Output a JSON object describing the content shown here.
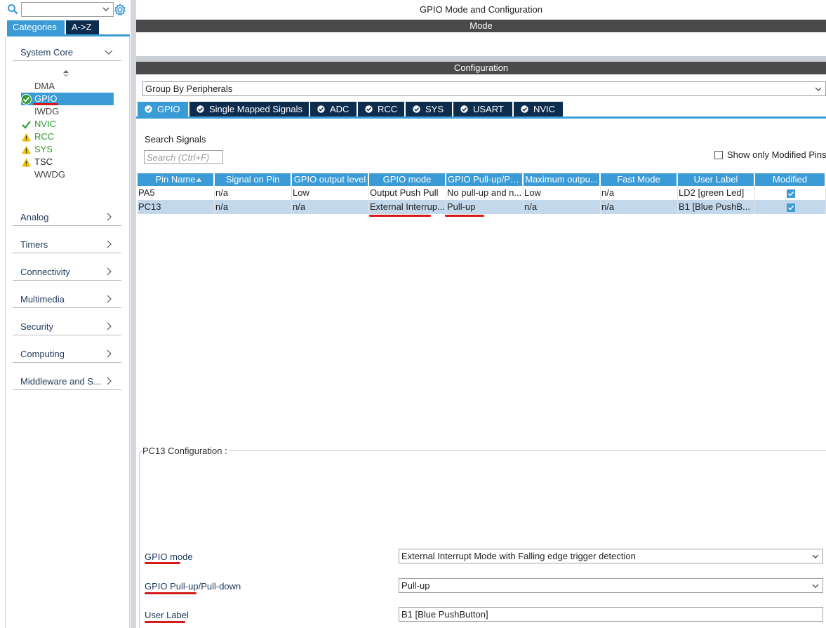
{
  "left": {
    "tabs": {
      "categories": "Categories",
      "az": "A->Z"
    },
    "system_core": "System Core",
    "items": [
      {
        "label": "DMA",
        "status": "none"
      },
      {
        "label": "GPIO",
        "status": "ok-selected"
      },
      {
        "label": "IWDG",
        "status": "none"
      },
      {
        "label": "NVIC",
        "status": "ok"
      },
      {
        "label": "RCC",
        "status": "warn"
      },
      {
        "label": "SYS",
        "status": "warn"
      },
      {
        "label": "TSC",
        "status": "warn"
      },
      {
        "label": "WWDG",
        "status": "none"
      }
    ],
    "categories": [
      "Analog",
      "Timers",
      "Connectivity",
      "Multimedia",
      "Security",
      "Computing",
      "Middleware and S..."
    ]
  },
  "right": {
    "title": "GPIO Mode and Configuration",
    "mode_bar": "Mode",
    "config_bar": "Configuration",
    "group_by": "Group By Peripherals",
    "tabs": [
      "GPIO",
      "Single Mapped Signals",
      "ADC",
      "RCC",
      "SYS",
      "USART",
      "NVIC"
    ],
    "search_label": "Search Signals",
    "search_placeholder": "Search (Ctrl+F)",
    "show_modified": "Show only Modified Pins",
    "columns": [
      "Pin Name",
      "Signal on Pin",
      "GPIO output level",
      "GPIO mode",
      "GPIO Pull-up/Pu...",
      "Maximum outpu...",
      "Fast Mode",
      "User Label",
      "Modified"
    ],
    "rows": [
      {
        "pin": "PA5",
        "signal": "n/a",
        "level": "Low",
        "mode": "Output Push Pull",
        "pull": "No pull-up and n...",
        "speed": "Low",
        "fast": "n/a",
        "label": "LD2 [green Led]",
        "modified": true
      },
      {
        "pin": "PC13",
        "signal": "n/a",
        "level": "n/a",
        "mode": "External Interrup...",
        "pull": "Pull-up",
        "speed": "n/a",
        "fast": "n/a",
        "label": "B1 [Blue PushB...",
        "modified": true
      }
    ],
    "config_title": "PC13 Configuration :",
    "fields": {
      "gpio_mode_label": "GPIO mode",
      "gpio_mode_value": "External Interrupt Mode with Falling edge trigger detection",
      "pull_label": "GPIO Pull-up/Pull-down",
      "pull_value": "Pull-up",
      "user_label_label": "User Label",
      "user_label_value": "B1 [Blue PushButton]"
    }
  },
  "colors": {
    "accent": "#3a9bd6",
    "dark_tab": "#0d2d4f",
    "bar": "#4a4a4a",
    "ok": "#2e9d2e",
    "warn": "#f2c200",
    "annotation": "#d61a1a"
  }
}
